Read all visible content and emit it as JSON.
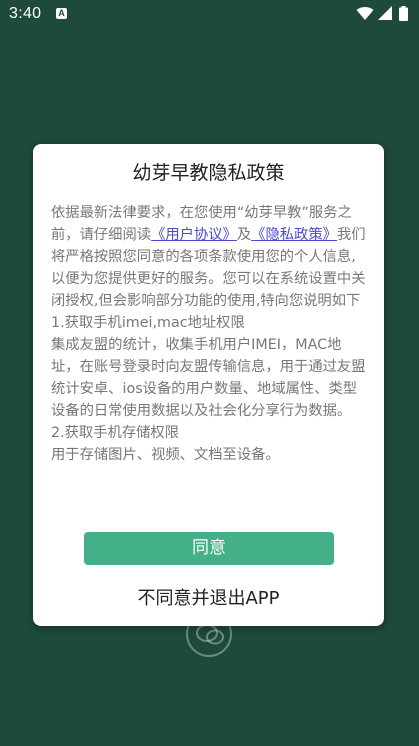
{
  "status_bar": {
    "time": "3:40",
    "notification_icon": "a-square-icon",
    "wifi_icon": "wifi-icon",
    "signal_icon": "signal-icon",
    "battery_icon": "battery-icon"
  },
  "background": {
    "color": "#1e4a3a",
    "icon": "chat-bubble-icon"
  },
  "dialog": {
    "title": "幼芽早教隐私政策",
    "intro_before_links": "依据最新法律要求，在您使用“幼芽早教”服务之前，请仔细阅读",
    "user_agreement_link": "《用户协议》",
    "and_text": "及",
    "privacy_policy_link": "《隐私政策》",
    "intro_after_links": "我们将严格按照您同意的各项条款使用您的个人信息,以便为您提供更好的服务。您可以在系统设置中关闭授权,但会影响部分功能的使用,特向您说明如下",
    "section1_title": "1.获取手机imei,mac地址权限",
    "section1_body": "集成友盟的统计，收集手机用户IMEI，MAC地址，在账号登录时向友盟传输信息，用于通过友盟统计安卓、ios设备的用户数量、地域属性、类型设备的日常使用数据以及社会化分享行为数据。",
    "section2_title": "2.获取手机存储权限",
    "section2_body": "用于存储图片、视频、文档至设备。",
    "agree_label": "同意",
    "disagree_label": "不同意并退出APP",
    "accent_color": "#43b088",
    "link_color": "#4a4ad0"
  }
}
